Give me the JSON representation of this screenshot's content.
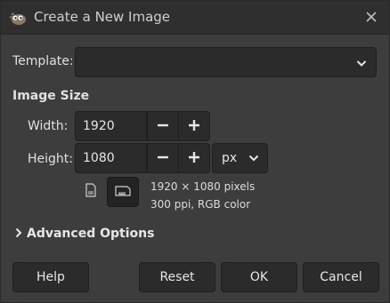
{
  "window": {
    "title": "Create a New Image"
  },
  "template": {
    "label": "Template:",
    "value": ""
  },
  "image_size": {
    "heading": "Image Size",
    "width_label": "Width:",
    "width_value": "1920",
    "height_label": "Height:",
    "height_value": "1080",
    "unit": "px",
    "info_line1": "1920 × 1080 pixels",
    "info_line2": "300 ppi, RGB color"
  },
  "advanced": {
    "label": "Advanced Options"
  },
  "buttons": {
    "help": "Help",
    "reset": "Reset",
    "ok": "OK",
    "cancel": "Cancel"
  },
  "icons": {
    "app": "gimp-wilber-icon",
    "close": "close-icon",
    "minus": "minus-icon",
    "plus": "plus-icon",
    "chevron": "chevron-down-icon",
    "portrait": "portrait-orientation-icon",
    "landscape": "landscape-orientation-icon",
    "expander": "chevron-right-icon"
  }
}
